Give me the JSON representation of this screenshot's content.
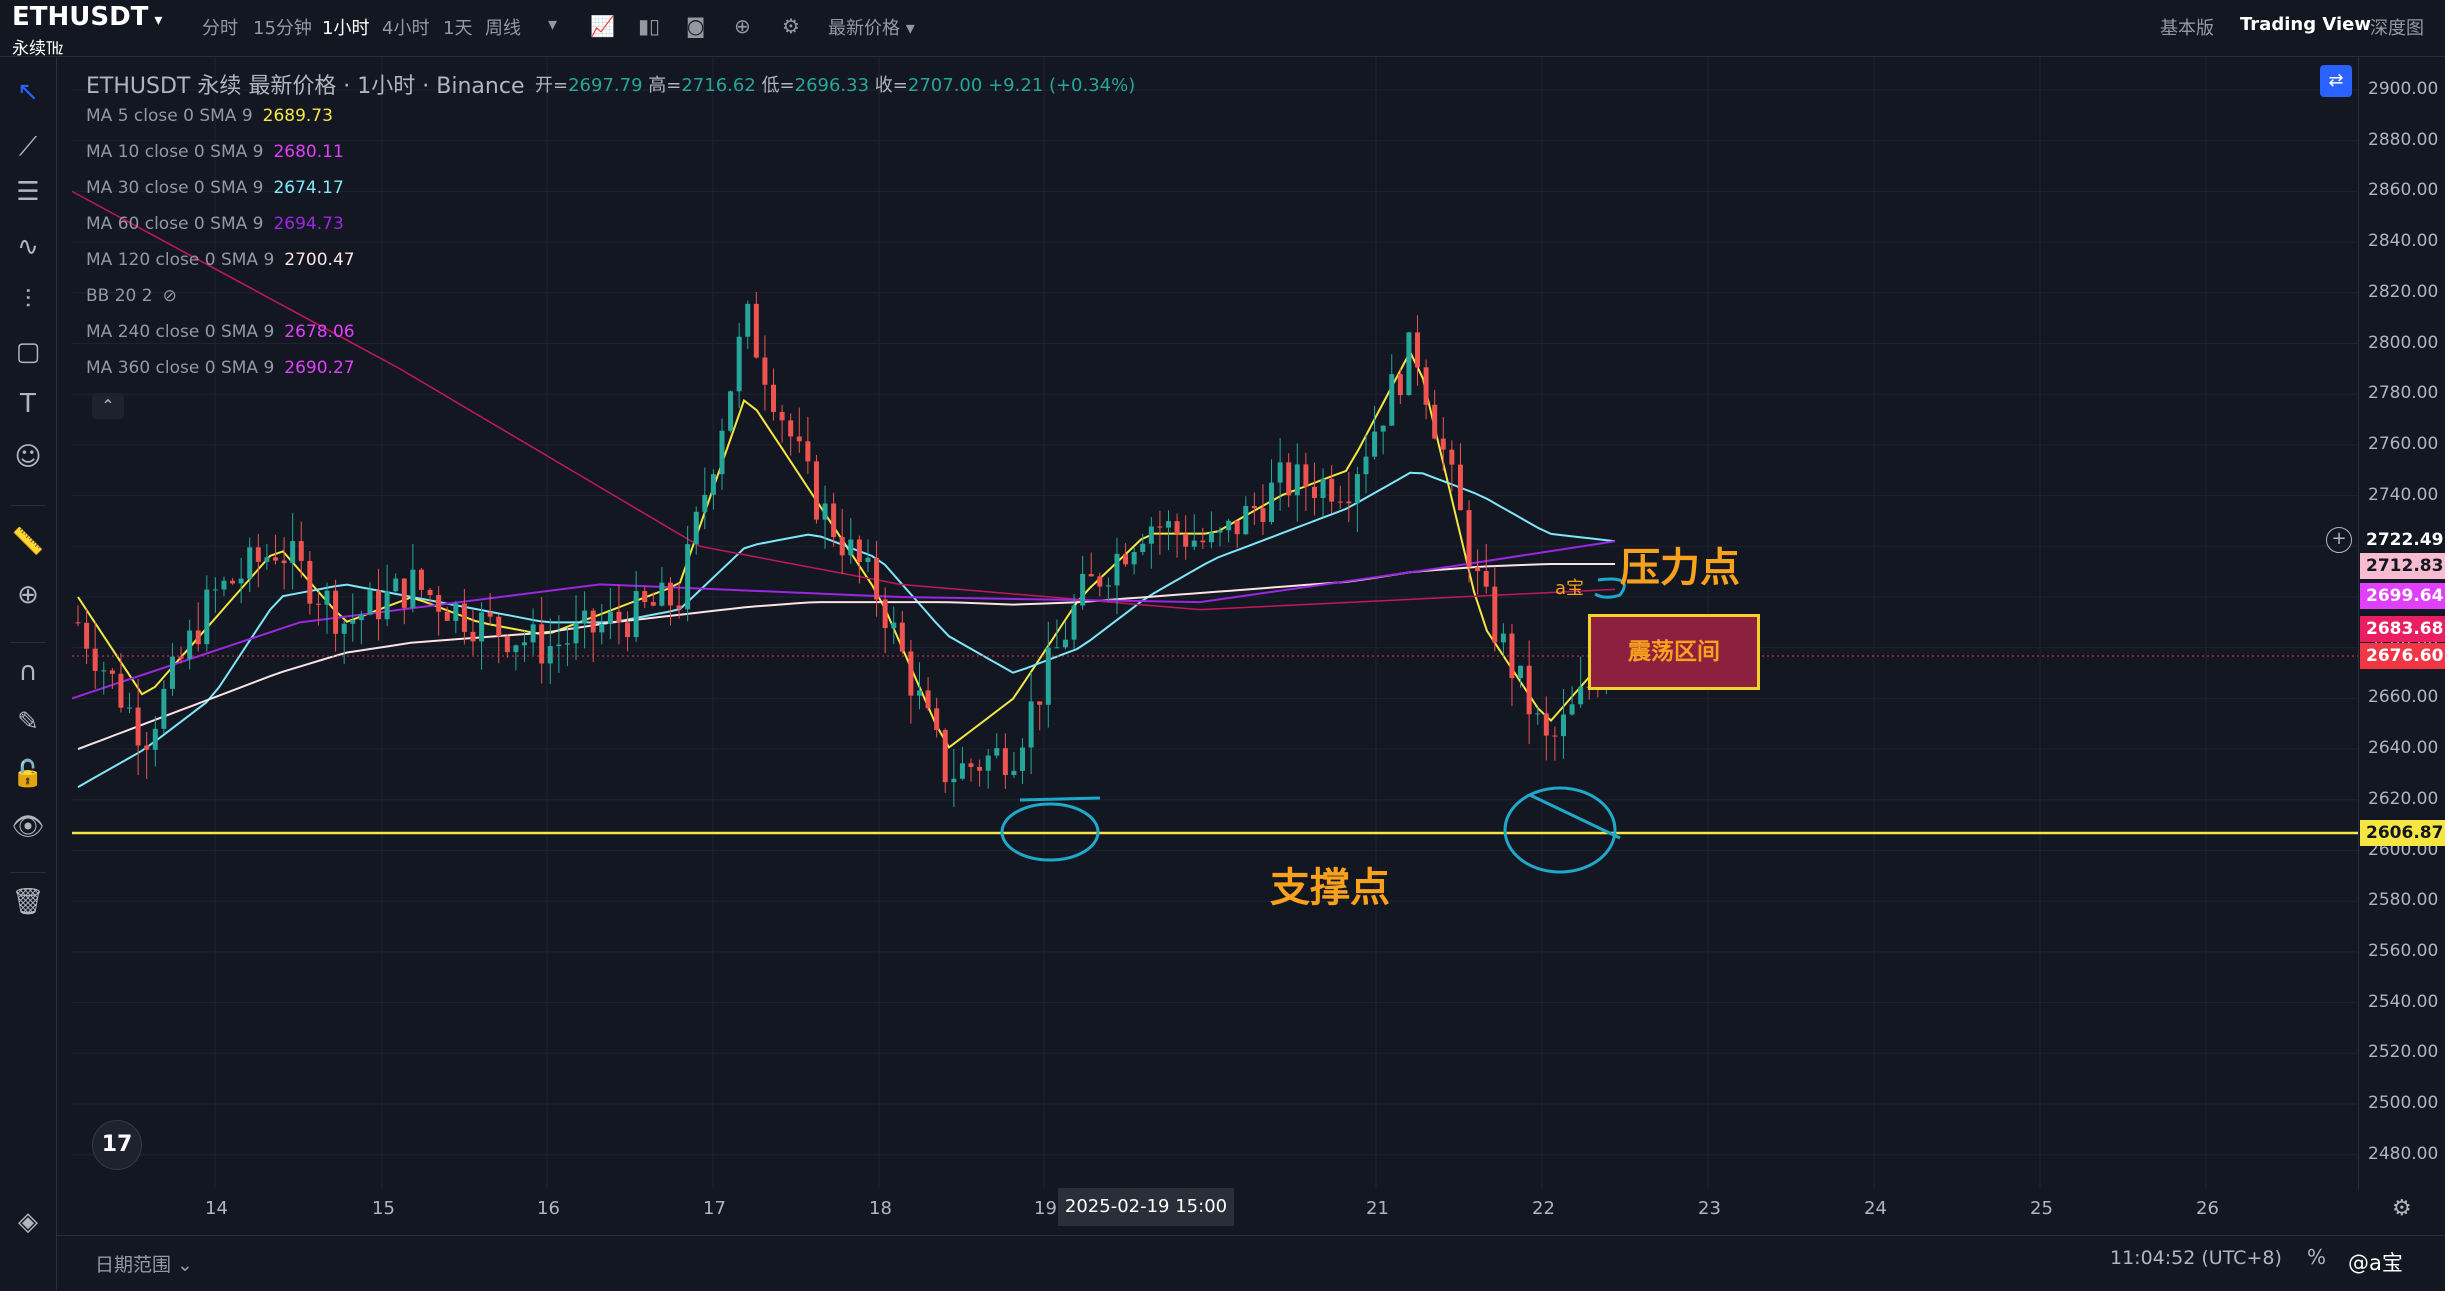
{
  "header": {
    "symbol": "ETHUSDT",
    "symbol_caret": "▾",
    "contract": "永续㎔",
    "timeframes": [
      "分时",
      "15分钟",
      "1小时",
      "4小时",
      "1天",
      "周线"
    ],
    "active_timeframe": "1小时",
    "timeframe_more": "▾",
    "price_mode": "最新价格 ▾",
    "views": [
      "基本版",
      "Trading View",
      "深度图"
    ],
    "active_view": "Trading View"
  },
  "legend": {
    "title": "ETHUSDT 永续 最新价格 · 1小时 · Binance",
    "open_label": "开=",
    "open": "2697.79",
    "high_label": "高=",
    "high": "2716.62",
    "low_label": "低=",
    "low": "2696.33",
    "close_label": "收=",
    "close": "2707.00",
    "change": "+9.21 (+0.34%)",
    "indicators": [
      {
        "label": "MA 5 close 0 SMA 9",
        "value": "2689.73",
        "color": "#f5e642"
      },
      {
        "label": "MA 10 close 0 SMA 9",
        "value": "2680.11",
        "color": "#e040fb"
      },
      {
        "label": "MA 30 close 0 SMA 9",
        "value": "2674.17",
        "color": "#7ee8fa"
      },
      {
        "label": "MA 60 close 0 SMA 9",
        "value": "2694.73",
        "color": "#9c27e0"
      },
      {
        "label": "MA 120 close 0 SMA 9",
        "value": "2700.47",
        "color": "#fbe3e3"
      },
      {
        "label": "BB 20 2",
        "value": "",
        "color": "#787b86"
      },
      {
        "label": "MA 240 close 0 SMA 9",
        "value": "2678.06",
        "color": "#e040fb"
      },
      {
        "label": "MA 360 close 0 SMA 9",
        "value": "2690.27",
        "color": "#e040fb"
      }
    ]
  },
  "price_axis": {
    "ticks": [
      "2900.00",
      "2880.00",
      "2860.00",
      "2840.00",
      "2820.00",
      "2800.00",
      "2780.00",
      "2760.00",
      "2740.00",
      "2720.00",
      "2700.00",
      "2680.00",
      "2660.00",
      "2640.00",
      "2620.00",
      "2600.00",
      "2580.00",
      "2560.00",
      "2540.00",
      "2520.00",
      "2500.00",
      "2480.00"
    ],
    "labels": [
      {
        "value": "2722.49",
        "bg": "#131722",
        "fg": "#ffffff"
      },
      {
        "value": "2712.83",
        "bg": "#f8bbd0",
        "fg": "#131722"
      },
      {
        "value": "2699.64",
        "bg": "#e040fb",
        "fg": "#ffffff"
      },
      {
        "value": "2683.68",
        "bg": "#e91e63",
        "fg": "#ffffff"
      },
      {
        "value": "2676.60",
        "bg": "#f23645",
        "fg": "#ffffff"
      },
      {
        "value": "2606.87",
        "bg": "#f5e642",
        "fg": "#131722"
      }
    ]
  },
  "time_axis": {
    "ticks": [
      "14",
      "15",
      "16",
      "17",
      "18",
      "19",
      "21",
      "22",
      "23",
      "24",
      "25",
      "26"
    ],
    "crosshair_label": "2025-02-19    15:00"
  },
  "annotations": {
    "pressure": "压力点",
    "support": "支撑点",
    "range_box": "震荡区间",
    "small_tag": "a宝"
  },
  "bottom": {
    "date_range": "日期范围 ⌄",
    "clock": "11:04:52 (UTC+8)",
    "percent": "%",
    "watermark": "@a宝"
  },
  "chart_data": {
    "type": "candlestick",
    "title": "ETHUSDT 永续 最新价格 · 1小时 · Binance",
    "ylim": [
      2470,
      2910
    ],
    "support_line": 2606.87,
    "current_price": 2676.6,
    "x": [
      "14",
      "15",
      "16",
      "17",
      "18",
      "19",
      "21",
      "22"
    ],
    "candles_close": [
      2690,
      2645,
      2700,
      2720,
      2690,
      2705,
      2690,
      2680,
      2690,
      2700,
      2810,
      2740,
      2700,
      2630,
      2640,
      2700,
      2730,
      2720,
      2745,
      2745,
      2800,
      2700,
      2640,
      2680
    ],
    "series": [
      {
        "name": "MA 5",
        "values": [
          2700,
          2660,
          2690,
          2720,
          2690,
          2700,
          2690,
          2685,
          2695,
          2705,
          2780,
          2740,
          2700,
          2640,
          2660,
          2700,
          2725,
          2725,
          2740,
          2750,
          2800,
          2690,
          2650,
          2680
        ]
      },
      {
        "name": "MA 30",
        "values": [
          2625,
          2640,
          2660,
          2700,
          2705,
          2700,
          2695,
          2690,
          2690,
          2695,
          2720,
          2725,
          2715,
          2685,
          2670,
          2680,
          2700,
          2715,
          2725,
          2735,
          2750,
          2740,
          2725,
          2722
        ]
      },
      {
        "name": "MA 120",
        "values": [
          2640,
          2650,
          2660,
          2670,
          2678,
          2682,
          2684,
          2686,
          2690,
          2693,
          2696,
          2698,
          2698,
          2698,
          2697,
          2698,
          2700,
          2702,
          2704,
          2706,
          2710,
          2712,
          2713,
          2713
        ]
      }
    ]
  }
}
